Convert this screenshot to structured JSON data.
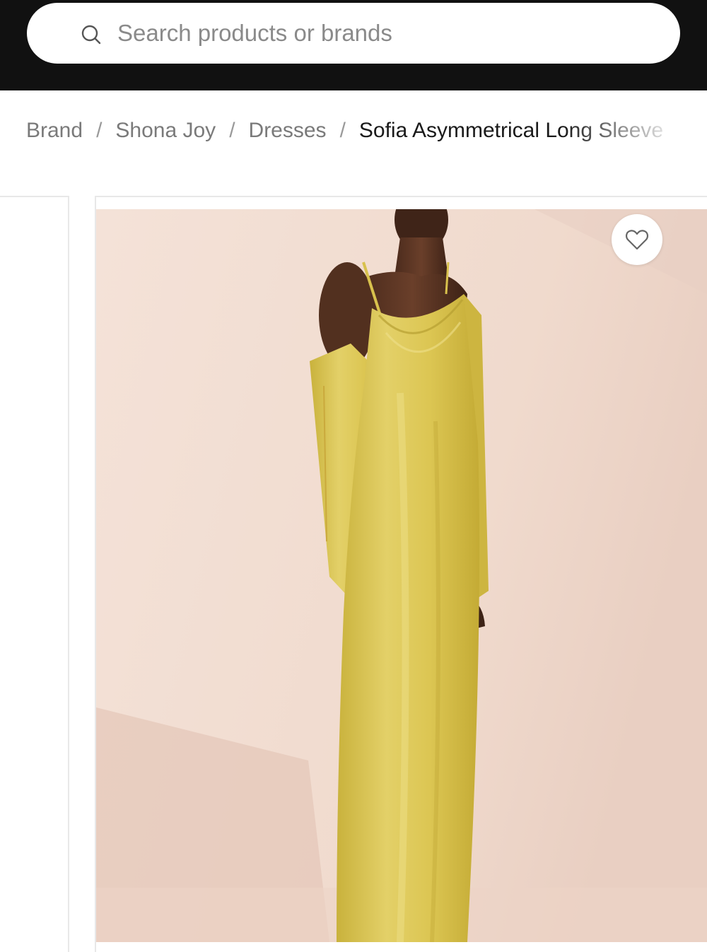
{
  "search": {
    "placeholder": "Search products or brands",
    "icon": "search-icon"
  },
  "breadcrumb": {
    "items": [
      "Brand",
      "Shona Joy",
      "Dresses"
    ],
    "separator": "/",
    "current": "Sofia Asymmetrical Long Sleeve"
  },
  "product": {
    "image_alt": "Yellow satin asymmetrical long sleeve dress",
    "wishlist_icon": "heart-outline-icon"
  },
  "colors": {
    "header_bg": "#111111",
    "dress": "#d9c450",
    "backdrop": "#f1dcd1"
  }
}
